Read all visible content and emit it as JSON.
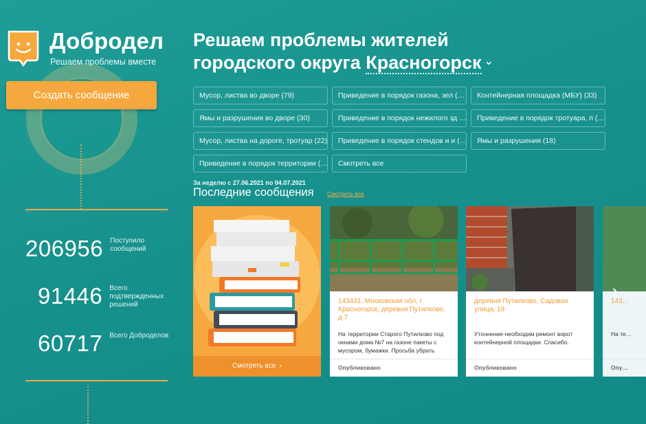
{
  "brand": {
    "name": "Добродел",
    "tagline": "Решаем проблемы вместе"
  },
  "create_button": "Создать сообщение",
  "stats": [
    {
      "value": "206956",
      "label": "Поступило сообщений"
    },
    {
      "value": "91446",
      "label": "Всего подтвержденных решений"
    },
    {
      "value": "60717",
      "label": "Всего Добродел‌ов"
    }
  ],
  "headline": {
    "line1": "Решаем проблемы жителей",
    "line2_prefix": "городского округа",
    "city": "Красногорск"
  },
  "categories": [
    "Мусор, листва во дворе (79)",
    "Приведение в порядок газона, зел (…",
    "Контейнерная площадка (МБУ) (33)",
    "Ямы и разрушения во дворе (30)",
    "Приведение в порядок нежилого зд …",
    "Приведение в порядок тротуара, п (…",
    "Мусор, листва на дороге, тротуар (22)",
    "Приведение в порядок стендов и и (…",
    "Ямы и разрушения (18)",
    "Приведение в порядок территории (…",
    "Смотреть все"
  ],
  "week": {
    "prefix": "За неделю с",
    "from": "27.06.2021",
    "mid": "по",
    "to": "04.07.2021"
  },
  "recent": {
    "title": "Последние сообщения",
    "see_all": "Смотреть все"
  },
  "cards": [
    {
      "address": "143441, Московская обл, г Красногорск, деревня Путилково, д 7",
      "text": "На территории Старого Путилково под окнами дома №7 на газоне пакеты с мусором, бумажки. Просьба убрать",
      "status": "Опубликовано"
    },
    {
      "address": "деревня Путилково, Садовая улица, 18",
      "text": "Уточнение-необходим ремонт ворот контейнерной площадки. Спасибо.",
      "status": "Опубликовано"
    },
    {
      "address": "143…",
      "text": "На те…",
      "status": "Опу…"
    }
  ],
  "orange_card": {
    "see_all": "Смотреть все"
  },
  "colors": {
    "background": "#17918d",
    "accent_orange": "#f6a83e",
    "address_orange": "#f09a33"
  }
}
